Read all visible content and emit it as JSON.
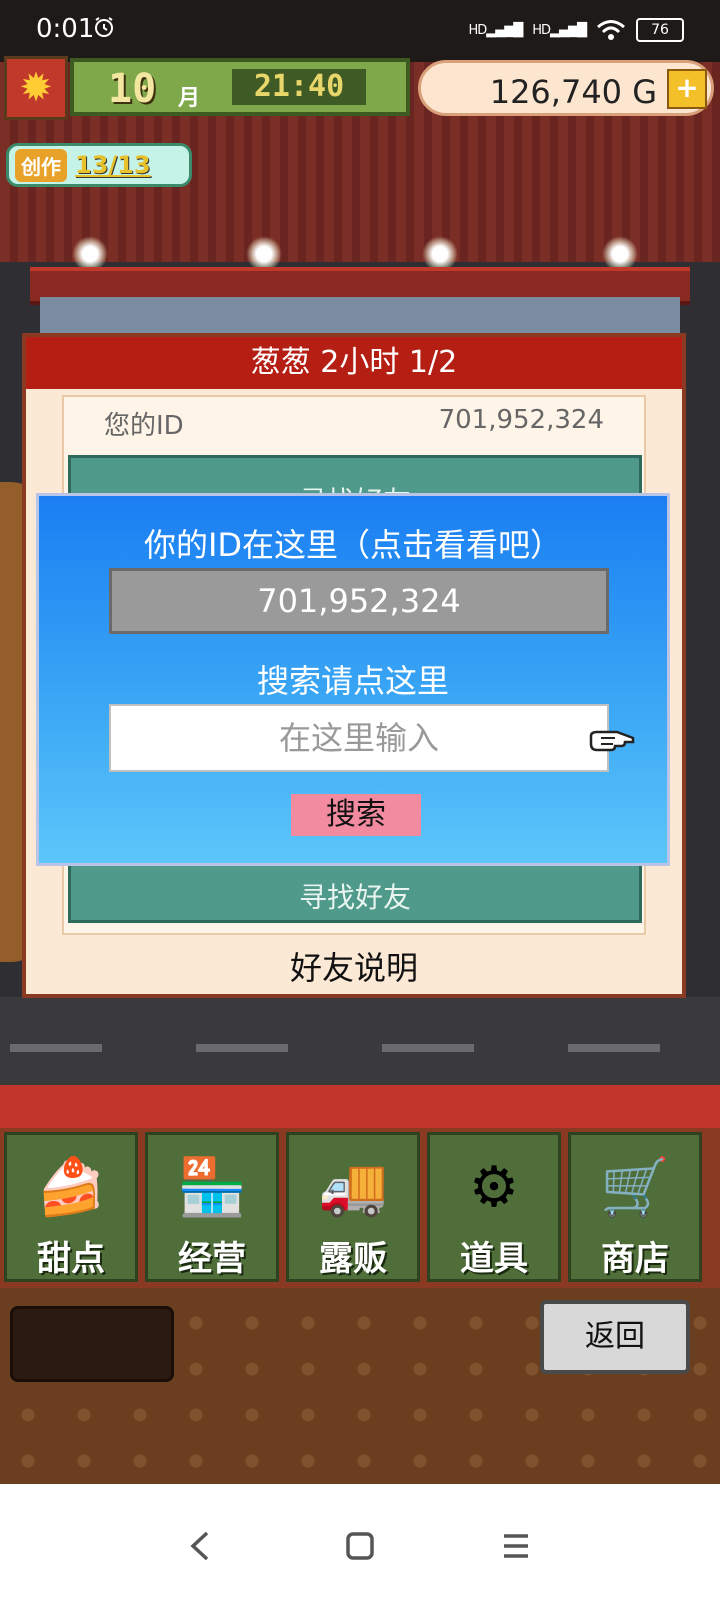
{
  "status_bar": {
    "time": "0:01",
    "signal1": "HD▂▄▆█",
    "signal2": "HD▂▄▆█",
    "battery": "76"
  },
  "hud": {
    "month_number": "10",
    "month_label": "月",
    "clock": "21:40",
    "money": "126,740 G",
    "money_add": "+",
    "craft_label": "创作",
    "craft_count": "13/13"
  },
  "panel": {
    "header": "葱葱  2小时 1/2",
    "id_label": "您的ID",
    "id_value": "701,952,324",
    "find_friend_upper": "寻找好友",
    "find_friend_lower": "寻找好友",
    "friend_guide": "好友说明"
  },
  "dialog": {
    "title": "你的ID在这里（点击看看吧）",
    "id_display": "701,952,324",
    "search_hint": "搜索请点这里",
    "input_placeholder": "在这里输入",
    "search_button": "搜索"
  },
  "menu": [
    {
      "label": "甜点",
      "icon": "cake-icon"
    },
    {
      "label": "经营",
      "icon": "shop-icon"
    },
    {
      "label": "露贩",
      "icon": "food-truck-icon"
    },
    {
      "label": "道具",
      "icon": "items-bag-icon"
    },
    {
      "label": "商店",
      "icon": "cart-icon"
    }
  ],
  "back_button": "返回",
  "colors": {
    "dialog_top": "#1a7ef2",
    "dialog_bottom": "#5cc6fa",
    "panel_header": "#b51e12",
    "search_button": "#f28aa0",
    "menu_green": "#4f6e3a"
  }
}
